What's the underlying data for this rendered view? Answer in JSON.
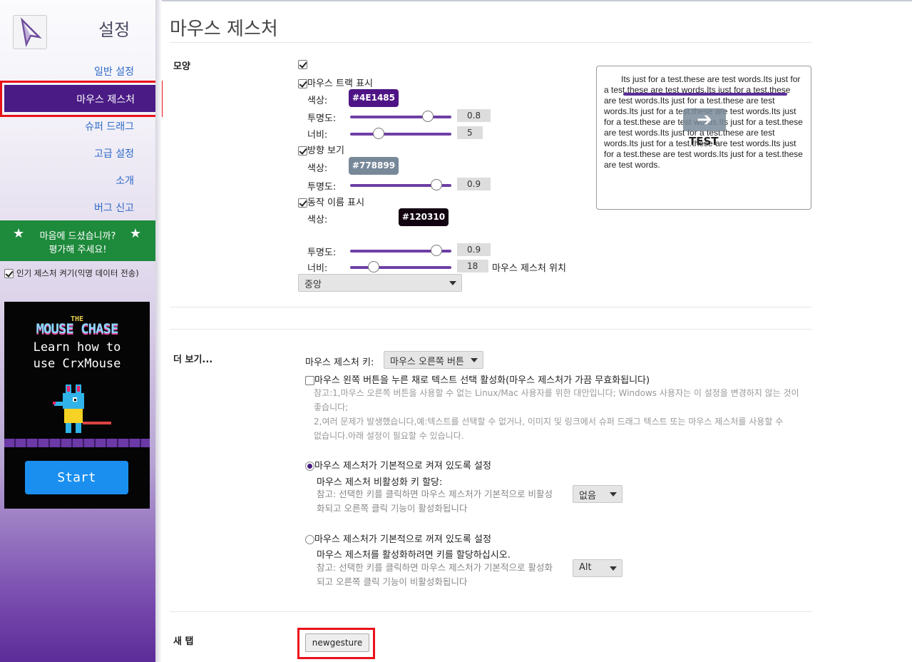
{
  "sidebar": {
    "title": "설정",
    "nav": [
      "일반 설정",
      "마우스 제스처",
      "슈퍼 드래그",
      "고급 설정",
      "소개",
      "버그 신고"
    ],
    "active_index": 1,
    "rate_line1": "마음에 드셨습니까?",
    "rate_line2": "평가해 주세요!",
    "popular_label": "인기 제스처 켜기(익명 데이터 전송)",
    "popular_checked": true,
    "ad": {
      "the": "THE",
      "title": "MOUSE CHASE",
      "line1": "Learn how to",
      "line2": "use CrxMouse",
      "start": "Start"
    }
  },
  "page": {
    "title": "마우스 제스처"
  },
  "appearance": {
    "section": "모양",
    "enable_checked": true,
    "trail": {
      "label": "마우스 트랙 표시",
      "checked": true,
      "color_label": "색상:",
      "color": "#4E1485",
      "opacity_label": "투명도:",
      "opacity": "0.8",
      "opacity_frac": 0.8,
      "width_label": "너비:",
      "width": "5",
      "width_frac": 0.25
    },
    "direction": {
      "label": "방향 보기",
      "checked": true,
      "color_label": "색상:",
      "color": "#778899",
      "opacity_label": "투명도:",
      "opacity": "0.9",
      "opacity_frac": 0.9
    },
    "action_name": {
      "label": "동작 이름 표시",
      "checked": true,
      "color_label": "색상:",
      "color": "#120310",
      "opacity_label": "투명도:",
      "opacity": "0.9",
      "opacity_frac": 0.9,
      "width_label": "너비:",
      "width": "18",
      "width_frac": 0.2,
      "position_label": "마우스 제스처 위치",
      "position_value": "중앙"
    },
    "preview_text": "Its just for a test.these are test words.Its just for a test.these are test words.Its just for a test.these are test words.Its just for a test.these are test words.Its just for a test.these are test words.Its just for a test.these are test words.Its just for a test.these are test words.Its just for a test.these are test words.Its just for a test.these are test words.Its just for a test.these are test words.Its just for a test.these are test words.",
    "preview_label": "TEST"
  },
  "more": {
    "section": "더 보기...",
    "key_label": "마우스 제스처 키:",
    "key_value": "마우스 오른쪽 버튼",
    "left_select_label": "마우스 왼쪽 버튼을 누른 채로 텍스트 선택 활성화(마우스 제스처가 가끔 무효화됩니다)",
    "left_select_checked": false,
    "note1a": "참고:1,마우스 오른쪽 버튼을 사용할 수 없는 Linux/Mac 사용자를 위한 대안입니다; Windows 사용자는 이 설정을 변경하지 않는 것이",
    "note1b": "좋습니다;",
    "note1c": "2,여러 문제가 발생했습니다,예:텍스트를 선택할 수 없거나, 이미지 및 링크에서 슈퍼 드래그 텍스트 또는 마우스 제스처를 사용할 수",
    "note1d": "없습니다.아래 설정이 필요할 수 있습니다.",
    "on_label": "마우스 제스처가 기본적으로 켜져 있도록 설정",
    "on_checked": true,
    "disable_key_label": "마우스 제스처 비활성화 키 할당:",
    "disable_note_a": "참고: 선택한 키를 클릭하면 마우스 제스처가 기본적으로 비활성",
    "disable_note_b": "화되고 오른쪽 클릭 기능이 활성화됩니다",
    "disable_key_value": "없음",
    "off_label": "마우스 제스처가 기본적으로 꺼져 있도록 설정",
    "enable_key_label": "마우스 제스처를 활성화하려면 키를 할당하십시오.",
    "enable_note_a": "참고: 선택한 키를 클릭하면 마우스 제스처가 기본적으로 활성화",
    "enable_note_b": "되고 오른쪽 클릭 기능이 비활성화됩니다",
    "enable_key_value": "Alt"
  },
  "newtab": {
    "section": "새 탭",
    "button": "newgesture"
  },
  "colors": {
    "accent": "#4E1485",
    "direction": "#778899",
    "action": "#120310",
    "rate_bg": "#1e8a3c",
    "highlight": "#e8121b"
  }
}
